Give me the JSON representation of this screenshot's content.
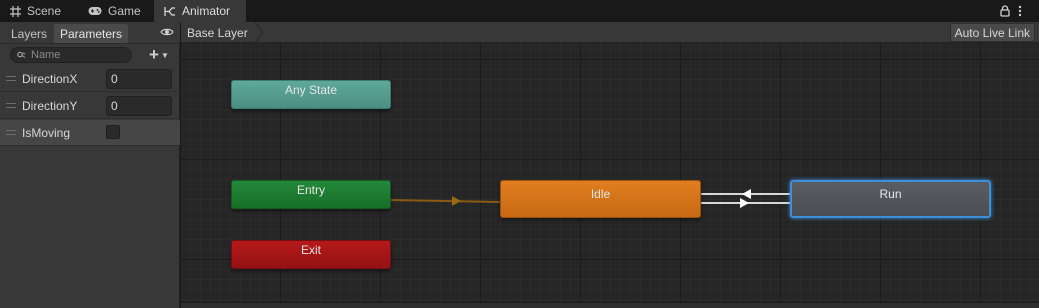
{
  "tabs": {
    "scene": "Scene",
    "game": "Game",
    "animator": "Animator"
  },
  "left_panel": {
    "tab_layers": "Layers",
    "tab_parameters": "Parameters",
    "search_placeholder": "Name",
    "parameters": [
      {
        "name": "DirectionX",
        "value": "0"
      },
      {
        "name": "DirectionY",
        "value": "0"
      },
      {
        "name": "IsMoving",
        "checked": false
      }
    ]
  },
  "graph": {
    "breadcrumb": "Base Layer",
    "auto_live_link": "Auto Live Link",
    "states": {
      "any_state": "Any State",
      "entry": "Entry",
      "exit": "Exit",
      "idle": "Idle",
      "run": "Run"
    }
  },
  "colors": {
    "any_state": "#5fa89b",
    "entry": "#23883a",
    "exit": "#b4191a",
    "idle": "#e07d20",
    "run": "#5a5e64",
    "selected_outline": "#3d8fd8",
    "default_transition": "#8a5a12"
  },
  "icons": {
    "scene": "grid-icon",
    "game": "gamepad-icon",
    "animator": "animator-graph-icon",
    "lock": "lock-icon",
    "menu": "kebab-menu-icon",
    "visibility": "eye-icon",
    "search": "search-icon",
    "add": "plus-icon"
  }
}
